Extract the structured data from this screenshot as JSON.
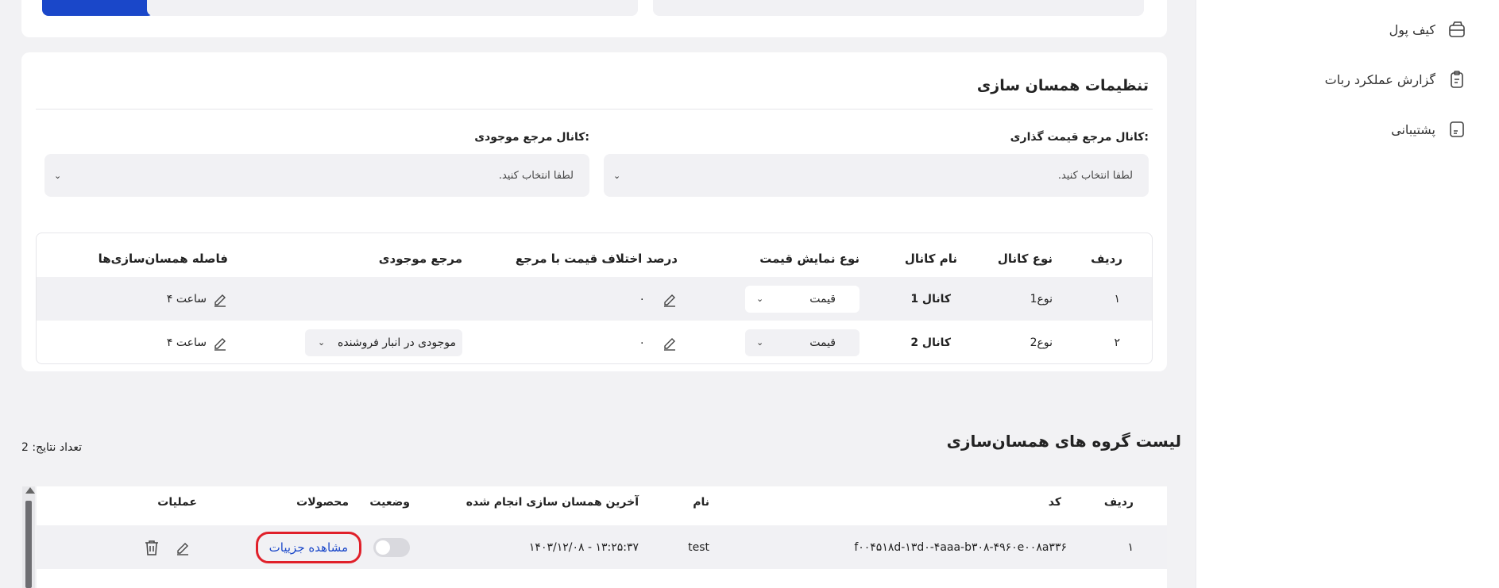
{
  "sidebar": {
    "items": [
      {
        "label": "کیف پول",
        "icon": "wallet-icon"
      },
      {
        "label": "گزارش عملکرد ربات",
        "icon": "clipboard-icon"
      },
      {
        "label": "پشتیبانی",
        "icon": "document-icon"
      }
    ]
  },
  "sync_settings": {
    "title": "تنظیمات همسان سازی",
    "pricing_channel_label": "کانال مرجع قیمت گذاری:",
    "pricing_channel_placeholder": "لطفا انتخاب کنید.",
    "stock_channel_label": "کانال مرجع موجودی:",
    "stock_channel_placeholder": "لطفا انتخاب کنید.",
    "table": {
      "headers": {
        "row": "ردیف",
        "channel_type": "نوع کانال",
        "channel_name": "نام کانال",
        "price_display": "نوع نمایش قیمت",
        "price_diff": "درصد اختلاف قیمت با مرجع",
        "stock_ref": "مرجع موجودی",
        "interval": "فاصله همسان‌سازی‌ها"
      },
      "rows": [
        {
          "row": "۱",
          "channel_type": "نوع1",
          "channel_name": "کانال 1",
          "price_display": "قیمت",
          "price_diff": "۰",
          "stock_ref": "",
          "interval": "۴ ساعت"
        },
        {
          "row": "۲",
          "channel_type": "نوع2",
          "channel_name": "کانال 2",
          "price_display": "قیمت",
          "price_diff": "۰",
          "stock_ref": "موجودی در انبار فروشنده",
          "interval": "۴ ساعت"
        }
      ]
    }
  },
  "groups": {
    "title": "لیست گروه های همسان‌سازی",
    "count_label": "تعداد نتایج: 2",
    "headers": {
      "row": "ردیف",
      "code": "کد",
      "name": "نام",
      "last_sync": "آخرین همسان سازی انجام شده",
      "status": "وضعیت",
      "products": "محصولات",
      "actions": "عملیات"
    },
    "rows": [
      {
        "row": "۱",
        "code": "f۰۰۴۵۱۸d-۱۳d۰-۴aaa-b۳۰۸-۴۹۶۰e۰۰۸a۳۳۶",
        "name": "test",
        "last_sync": "۱۴۰۳/۱۲/۰۸ - ۱۳:۲۵:۳۷",
        "status_on": false,
        "products_link": "مشاهده جزییات"
      }
    ]
  },
  "colors": {
    "primary": "#1a47c9",
    "highlight": "#e0202a",
    "row_bg": "#f1f1f4",
    "page_bg": "#f2f2f4"
  }
}
